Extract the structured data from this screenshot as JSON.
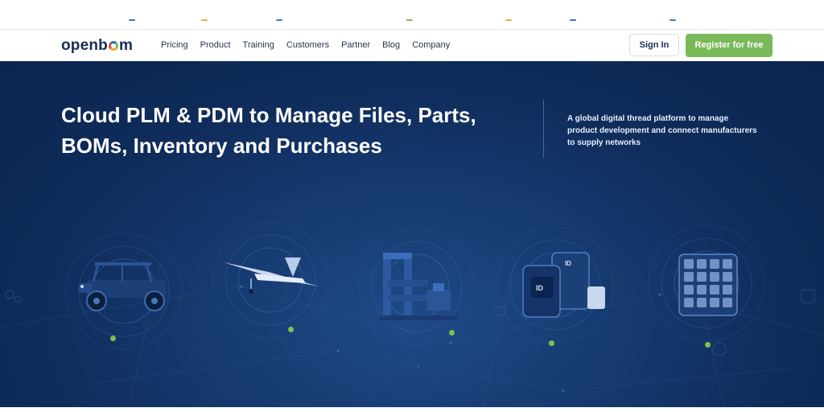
{
  "brand": {
    "name": "openbom",
    "prefix": "openb",
    "suffix": "m"
  },
  "nav": {
    "items": [
      {
        "label": "Pricing"
      },
      {
        "label": "Product"
      },
      {
        "label": "Training"
      },
      {
        "label": "Customers"
      },
      {
        "label": "Partner"
      },
      {
        "label": "Blog"
      },
      {
        "label": "Company"
      }
    ],
    "signin_label": "Sign In",
    "register_label": "Register for free"
  },
  "hero": {
    "headline_line1": "Cloud PLM & PDM to Manage Files, Parts,",
    "headline_line2": "BOMs, Inventory and Purchases",
    "subtext_line1": "A global digital thread platform to manage",
    "subtext_line2": "product development and connect manufacturers",
    "subtext_line3": "to supply networks"
  },
  "products": [
    {
      "icon": "utility-vehicle-icon"
    },
    {
      "icon": "drone-aircraft-icon"
    },
    {
      "icon": "industrial-machine-icon"
    },
    {
      "icon": "electronic-devices-icon"
    },
    {
      "icon": "parts-tray-icon"
    }
  ],
  "colors": {
    "brand_navy": "#1b2d55",
    "accent_green": "#7ab95a",
    "hero_blue": "#163a70"
  }
}
